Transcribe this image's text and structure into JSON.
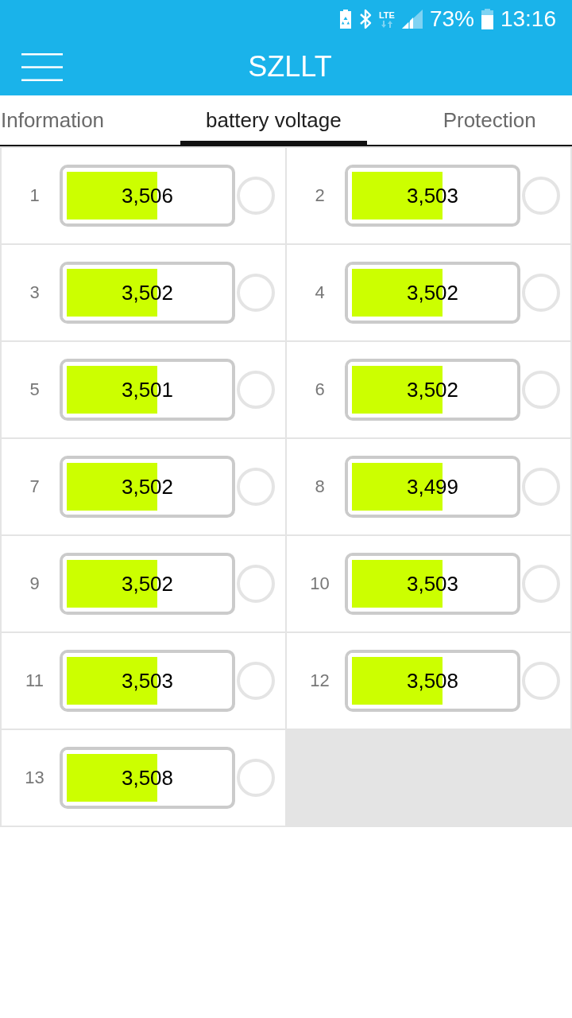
{
  "status_bar": {
    "network_type": "LTE",
    "battery_percent": "73%",
    "time": "13:16"
  },
  "app_bar": {
    "title": "SZLLT"
  },
  "tabs": [
    {
      "label": "Information",
      "selected": false
    },
    {
      "label": "battery voltage",
      "selected": true
    },
    {
      "label": "Protection",
      "selected": false
    }
  ],
  "cells": [
    {
      "number": "1",
      "voltage": "3,506",
      "level": 0.56
    },
    {
      "number": "2",
      "voltage": "3,503",
      "level": 0.56
    },
    {
      "number": "3",
      "voltage": "3,502",
      "level": 0.56
    },
    {
      "number": "4",
      "voltage": "3,502",
      "level": 0.56
    },
    {
      "number": "5",
      "voltage": "3,501",
      "level": 0.56
    },
    {
      "number": "6",
      "voltage": "3,502",
      "level": 0.56
    },
    {
      "number": "7",
      "voltage": "3,502",
      "level": 0.56
    },
    {
      "number": "8",
      "voltage": "3,499",
      "level": 0.56
    },
    {
      "number": "9",
      "voltage": "3,502",
      "level": 0.56
    },
    {
      "number": "10",
      "voltage": "3,503",
      "level": 0.56
    },
    {
      "number": "11",
      "voltage": "3,503",
      "level": 0.56
    },
    {
      "number": "12",
      "voltage": "3,508",
      "level": 0.56
    },
    {
      "number": "13",
      "voltage": "3,508",
      "level": 0.56
    }
  ]
}
